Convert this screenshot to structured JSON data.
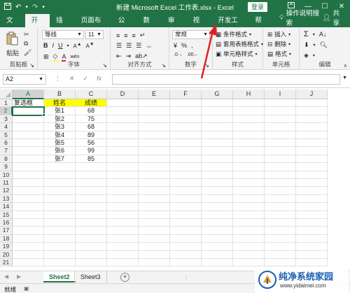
{
  "titlebar": {
    "title": "新建 Microsoft Excel 工作表.xlsx  -  Excel",
    "login_label": "登录",
    "restore_icon": "restore-icon",
    "minimize_glyph": "—",
    "maximize_glyph": "☐",
    "close_glyph": "✕"
  },
  "tabs": [
    "文件",
    "开始",
    "插入",
    "页面布局",
    "公式",
    "数据",
    "审阅",
    "视图",
    "开发工具",
    "帮助"
  ],
  "active_tab": "开始",
  "tell_me": "操作说明搜索",
  "share": "共享",
  "ribbon": {
    "clipboard": {
      "paste": "粘贴",
      "label": "剪贴板"
    },
    "font": {
      "name": "等线",
      "size": "11",
      "label": "字体",
      "bold": "B",
      "italic": "I",
      "underline": "U",
      "wen": "wén"
    },
    "alignment": {
      "label": "对齐方式"
    },
    "number": {
      "format": "常规",
      "percent": "%",
      "label": "数字"
    },
    "styles": {
      "conditional": "条件格式",
      "table_format": "套用表格格式",
      "cell_styles": "单元格样式",
      "label": "样式"
    },
    "cells": {
      "insert": "插入",
      "delete": "删除",
      "format": "格式",
      "label": "单元格"
    },
    "editing": {
      "label": "编辑"
    }
  },
  "formula_bar": {
    "name_box": "A2",
    "cancel": "✕",
    "enter": "✓",
    "fx": "fx",
    "value": ""
  },
  "columns": [
    "A",
    "B",
    "C",
    "D",
    "E",
    "F",
    "G",
    "H",
    "I",
    "J"
  ],
  "rows": [
    "1",
    "2",
    "3",
    "4",
    "5",
    "6",
    "7",
    "8",
    "9",
    "10",
    "11",
    "12",
    "13",
    "14",
    "15",
    "16",
    "17",
    "18",
    "19",
    "20",
    "21"
  ],
  "table": {
    "headers": [
      "复选框",
      "姓名",
      "成绩"
    ],
    "records": [
      [
        "",
        "张1",
        "68"
      ],
      [
        "",
        "张2",
        "75"
      ],
      [
        "",
        "张3",
        "68"
      ],
      [
        "",
        "张4",
        "89"
      ],
      [
        "",
        "张5",
        "56"
      ],
      [
        "",
        "张6",
        "99"
      ],
      [
        "",
        "张7",
        "85"
      ]
    ]
  },
  "sheets": [
    "Sheet2",
    "Sheet3"
  ],
  "active_sheet": "Sheet2",
  "status": "就绪",
  "watermark": {
    "title": "纯净系统家园",
    "url": "www.yidaimei.com"
  },
  "colors": {
    "excel_green": "#217346",
    "header_yellow": "#ffff00",
    "annotation_red": "#e02020"
  }
}
